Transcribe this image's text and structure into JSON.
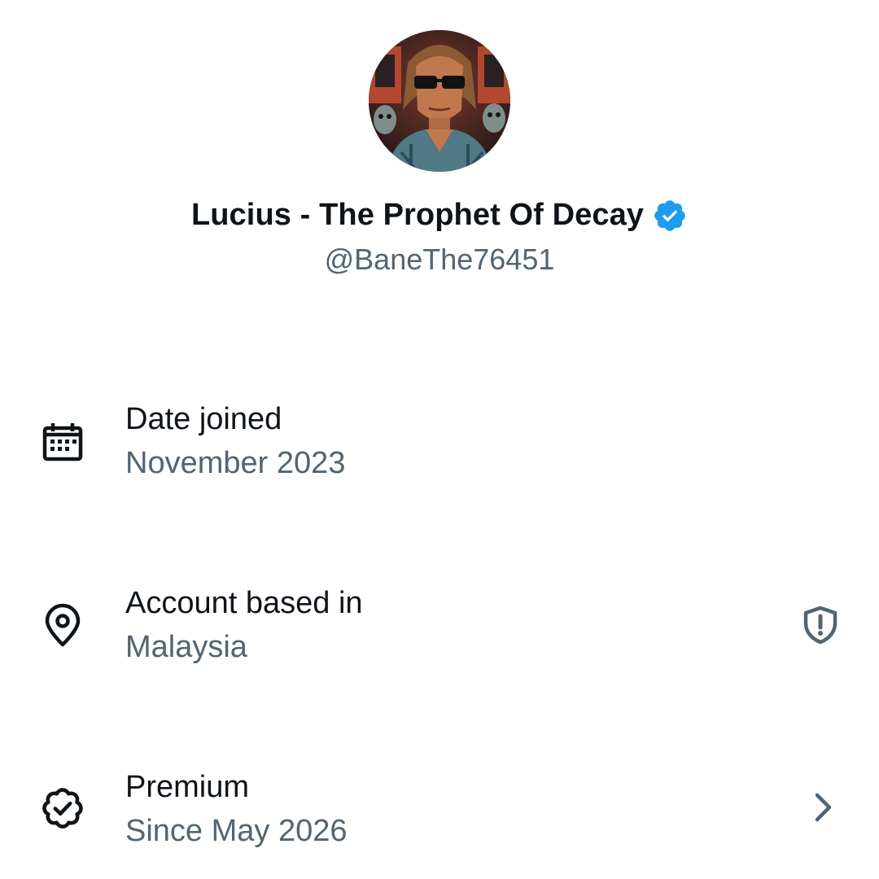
{
  "profile": {
    "display_name": "Lucius - The Prophet Of Decay",
    "handle": "@BaneThe76451",
    "verified": true,
    "verified_color": "#1d9bf0",
    "avatar_icon": "profile-avatar"
  },
  "details": [
    {
      "icon": "calendar-icon",
      "title": "Date joined",
      "value": "November 2023"
    },
    {
      "icon": "location-pin-icon",
      "title": "Account based in",
      "value": "Malaysia",
      "trailing_icon": "shield-alert-icon"
    },
    {
      "icon": "premium-badge-icon",
      "title": "Premium",
      "value": "Since May 2026",
      "trailing_icon": "chevron-right-icon"
    }
  ],
  "colors": {
    "primary_text": "#0f1419",
    "secondary_text": "#536471",
    "accent": "#1d9bf0"
  }
}
